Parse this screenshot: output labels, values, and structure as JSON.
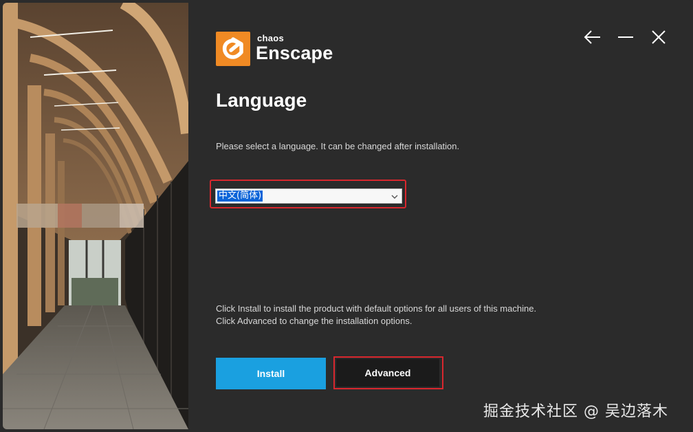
{
  "brand": {
    "company": "chaos",
    "product": "Enscape"
  },
  "window_controls": [
    {
      "name": "back-arrow-icon"
    },
    {
      "name": "minimize-icon"
    },
    {
      "name": "close-icon"
    }
  ],
  "page": {
    "title": "Language",
    "subtitle": "Please select a language. It can be changed after installation."
  },
  "language_select": {
    "selected": "中文(简体)",
    "icon": "chevron-down-icon"
  },
  "info": {
    "line1": "Click Install to install the product with default options for all users of this machine.",
    "line2": "Click Advanced to change the installation options."
  },
  "buttons": {
    "install": "Install",
    "advanced": "Advanced"
  },
  "colors": {
    "background": "#2b2b2b",
    "brand_orange": "#f08a24",
    "install_blue": "#1aa0e0",
    "highlight_red": "#d9272e"
  },
  "watermark": "掘金技术社区 @ 吴边落木"
}
